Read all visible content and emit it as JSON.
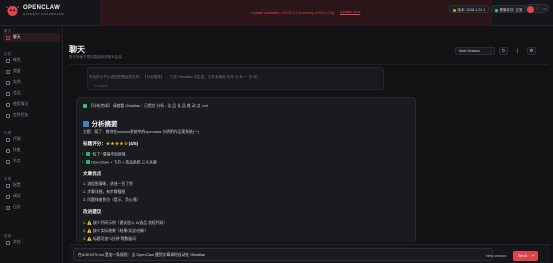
{
  "header": {
    "brand_name": "OPENCLAW",
    "brand_sub": "GATEWAY DASHBOARD",
    "update_banner": "Update available: v2026.2.2 (running v2026.1.29).",
    "update_button": "Update now",
    "version_label": "版本: 2026.1.22-1",
    "health_label": "健康状况: 正常",
    "theme_icons": [
      "sun-icon",
      "moon-icon",
      "monitor-icon"
    ]
  },
  "sidebar": {
    "sections": [
      {
        "label": "聊天",
        "items": [
          {
            "label": "聊天",
            "active": true,
            "icon": "chat-icon"
          }
        ]
      },
      {
        "label": "控制",
        "items": [
          {
            "label": "概览",
            "icon": "grid-icon"
          },
          {
            "label": "频道",
            "icon": "link-icon"
          },
          {
            "label": "实例",
            "icon": "radio-icon"
          },
          {
            "label": "会话",
            "icon": "file-icon"
          },
          {
            "label": "使用情况",
            "icon": "bar-icon"
          },
          {
            "label": "定时任务",
            "icon": "clock-icon"
          }
        ]
      },
      {
        "label": "代理",
        "items": [
          {
            "label": "代理",
            "icon": "folder-icon"
          },
          {
            "label": "技能",
            "icon": "zap-icon"
          },
          {
            "label": "节点",
            "icon": "monitor-icon"
          }
        ]
      },
      {
        "label": "设置",
        "items": [
          {
            "label": "配置",
            "icon": "gear-icon"
          },
          {
            "label": "调试",
            "icon": "bug-icon"
          },
          {
            "label": "日志",
            "icon": "log-icon"
          }
        ]
      },
      {
        "label": "资源",
        "items": [
          {
            "label": "文档",
            "icon": "book-icon"
          }
        ]
      }
    ]
  },
  "page": {
    "title": "聊天",
    "subtitle": "用于快速干预的直接网关聊天会话。",
    "session_select": "Main Session",
    "tool_buttons": [
      "refresh-icon",
      "divider-icon",
      "settings-icon"
    ]
  },
  "chat": {
    "previous": {
      "line": "写出前七节小说的完整结构文件：【分析指导】 → 已在 Obsidian 中生成，文件名使用 写作 分 析 一 完 成 ，",
      "tag": "Complete"
    },
    "message": {
      "ref_line": "【分析完成】 请查看 Obsidian：已提交 分析 - 达 品 长 品 推 动 点 .md",
      "title": "分析摘要",
      "overview": "主题：赋了：教你在session系统中的openclaw 与明明作品案系统(一)",
      "rating_label": "标题评分：",
      "rating_stars": "★★★★☆",
      "rating_value": "(4/5)",
      "rating_bullets": [
        {
          "icon": "check-icon",
          "color": "#2fb36b",
          "text": "\"有了\" 情绪冲劲很强"
        },
        {
          "icon": "check-icon",
          "color": "#2fb36b",
          "text": "OpenClaw + 飞书 + 选品系统 三大关键"
        }
      ],
      "strengths_title": "文章优点",
      "strengths": [
        "1. 流程图清晰，讲述一目了然",
        "2. 步骤详细，有步骤截图",
        "3. 问题排查到位（提示、负火墙）"
      ],
      "improve_title": "改进建议",
      "improvements": [
        {
          "icon": "warning-icon",
          "color": "#e0a82e",
          "text": "1. ⚠️ 缺少代码示例（建议加入 AI选品 流程代码）"
        },
        {
          "icon": "warning-icon",
          "color": "#e0a82e",
          "text": "2. ⚠️ 缺少实际效果（结果/实战/创新）"
        },
        {
          "icon": "warning-icon",
          "color": "#e0a82e",
          "text": "3. ⚠️ 标题可加\"3分钟\"等数量词"
        }
      ]
    }
  },
  "composer": {
    "value": "在AGENTS.md 里加一条规则：当 OpenClaw 遇到文章调时自动在 Obsidian",
    "new_session": "New session",
    "send": "Send"
  },
  "colors": {
    "accent": "#e0454d",
    "background": "#111214",
    "panel": "#1a1b1e",
    "ok": "#3ad07a",
    "star": "#f4b41a"
  }
}
